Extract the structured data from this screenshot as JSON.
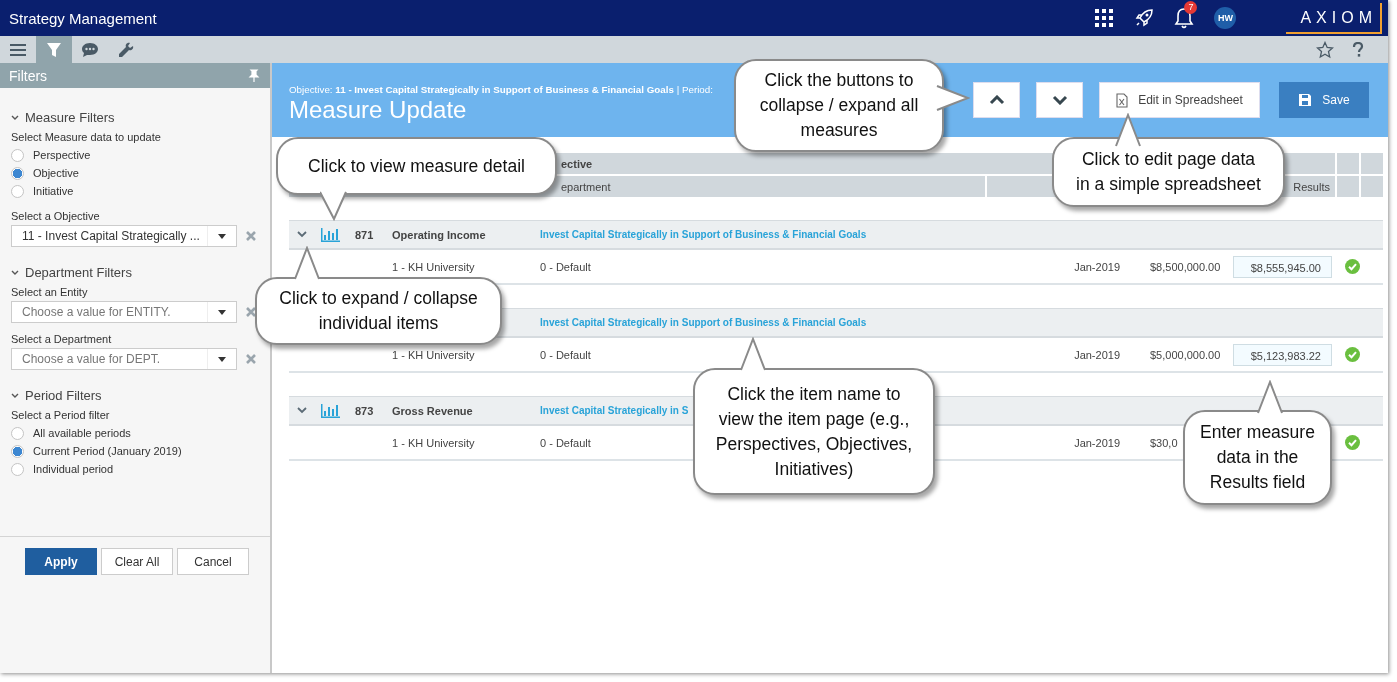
{
  "app_bar": {
    "title": "Strategy Management",
    "notification_count": "7",
    "avatar_initials": "HW",
    "logo": "AXIOM"
  },
  "toolbar": {
    "tabs": [
      {
        "kind": "menu",
        "selected": false
      },
      {
        "kind": "filter",
        "selected": true
      },
      {
        "kind": "chat",
        "selected": false
      },
      {
        "kind": "tools",
        "selected": false
      }
    ]
  },
  "filters_panel": {
    "title": "Filters",
    "sections": [
      {
        "title": "Measure Filters",
        "fields": [
          {
            "kind": "radio",
            "label": "Select Measure data to update",
            "options": [
              {
                "label": "Perspective",
                "selected": false
              },
              {
                "label": "Objective",
                "selected": true
              },
              {
                "label": "Initiative",
                "selected": false
              }
            ]
          },
          {
            "kind": "select",
            "label": "Select a Objective",
            "value": "11 - Invest Capital Strategically ..."
          }
        ]
      },
      {
        "title": "Department Filters",
        "fields": [
          {
            "kind": "select",
            "label": "Select an Entity",
            "placeholder": "Choose a value for ENTITY."
          },
          {
            "kind": "select",
            "label": "Select a Department",
            "placeholder": "Choose a value for DEPT."
          }
        ]
      },
      {
        "title": "Period Filters",
        "fields": [
          {
            "kind": "radio",
            "label": "Select a Period filter",
            "options": [
              {
                "label": "All available periods",
                "selected": false
              },
              {
                "label": "Current Period (January 2019)",
                "selected": true
              },
              {
                "label": "Individual period",
                "selected": false
              }
            ]
          }
        ]
      }
    ],
    "buttons": [
      {
        "label": "Apply",
        "kind": "primary"
      },
      {
        "label": "Clear All",
        "kind": "default"
      },
      {
        "label": "Cancel",
        "kind": "default"
      }
    ]
  },
  "page_header": {
    "objective_line": "Objective: **11 - Invest Capital Strategically in Support of Business & Financial Goals** | Period:",
    "title": "Measure Update",
    "buttons": [
      {
        "kind": "collapse"
      },
      {
        "kind": "expand"
      },
      {
        "kind": "spreadsheet",
        "label": "Edit in Spreadsheet"
      },
      {
        "kind": "save",
        "label": "Save"
      }
    ]
  },
  "table": {
    "header_row_1": {
      "column_1": "ective"
    },
    "header_row_2": {
      "column_1": "epartment",
      "column_3": "Results"
    },
    "measures": [
      {
        "expanded": true,
        "id": "871",
        "name": "Operating Income",
        "objective": "Invest Capital Strategically in Support of Business & Financial Goals",
        "rows": [
          {
            "entity": "1 - KH University",
            "department": "0 - Default",
            "period": "Jan-2019",
            "target": "$8,500,000.00",
            "result": "$8,555,945.00",
            "completed": true
          }
        ]
      },
      {
        "objective": "Invest Capital Strategically in Support of Business & Financial Goals",
        "rows": [
          {
            "entity": "1 - KH University",
            "department": "0 - Default",
            "period": "Jan-2019",
            "target": "$5,000,000.00",
            "result": "$5,123,983.22",
            "completed": true
          }
        ]
      },
      {
        "expanded": true,
        "id": "873",
        "name": "Gross Revenue",
        "objective": "Invest Capital Strategically in S",
        "rows": [
          {
            "entity": "1 - KH University",
            "department": "0 - Default",
            "period": "Jan-2019",
            "target": "$30,0",
            "completed": true
          }
        ]
      }
    ]
  },
  "callouts": [
    {
      "lines": [
        "Click the buttons to",
        "collapse / expand all",
        "measures"
      ]
    },
    {
      "lines": [
        "Click to view measure detail"
      ]
    },
    {
      "lines": [
        "Click to edit page data",
        "in a simple spreadsheet"
      ]
    },
    {
      "lines": [
        "Click to expand / collapse",
        "individual items"
      ]
    },
    {
      "lines": [
        "Click the item name to",
        "view the item page (e.g.,",
        "Perspectives, Objectives,",
        "Initiatives)"
      ]
    },
    {
      "lines": [
        "Enter measure",
        "data in the",
        "Results field"
      ]
    }
  ]
}
